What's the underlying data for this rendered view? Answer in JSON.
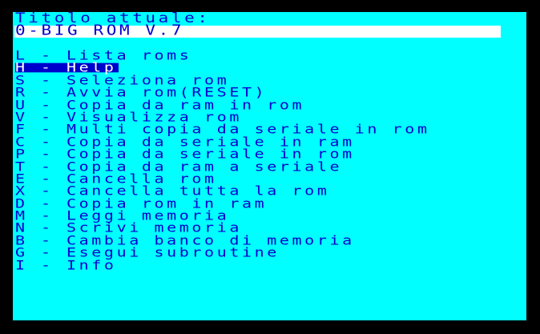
{
  "header": {
    "title": "Titolo attuale:",
    "current_rom": "0-BIG ROM V.7"
  },
  "menu": {
    "separator": "-",
    "selected_index": 1,
    "items": [
      {
        "key": "L",
        "label": "Lista roms"
      },
      {
        "key": "H",
        "label": "Help"
      },
      {
        "key": "S",
        "label": "Seleziona rom"
      },
      {
        "key": "R",
        "label": "Avvia rom(RESET)"
      },
      {
        "key": "U",
        "label": "Copia da ram in rom"
      },
      {
        "key": "V",
        "label": "Visualizza rom"
      },
      {
        "key": "F",
        "label": "Multi copia da seriale in rom"
      },
      {
        "key": "C",
        "label": "Copia da seriale in ram"
      },
      {
        "key": "P",
        "label": "Copia da seriale in rom"
      },
      {
        "key": "T",
        "label": "Copia da ram a seriale"
      },
      {
        "key": "E",
        "label": "Cancella rom"
      },
      {
        "key": "X",
        "label": "Cancella tutta la rom"
      },
      {
        "key": "D",
        "label": "Copia rom in ram"
      },
      {
        "key": "M",
        "label": "Leggi memoria"
      },
      {
        "key": "N",
        "label": "Scrivi memoria"
      },
      {
        "key": "B",
        "label": "Cambia banco di memoria"
      },
      {
        "key": "G",
        "label": "Esegui subroutine"
      },
      {
        "key": "I",
        "label": "Info"
      }
    ]
  },
  "colors": {
    "border": "#000000",
    "background": "#00ffff",
    "text": "#0000cc",
    "rom_bar": "#ffffff",
    "highlight_bg": "#0000cc",
    "highlight_text": "#ffffff"
  }
}
